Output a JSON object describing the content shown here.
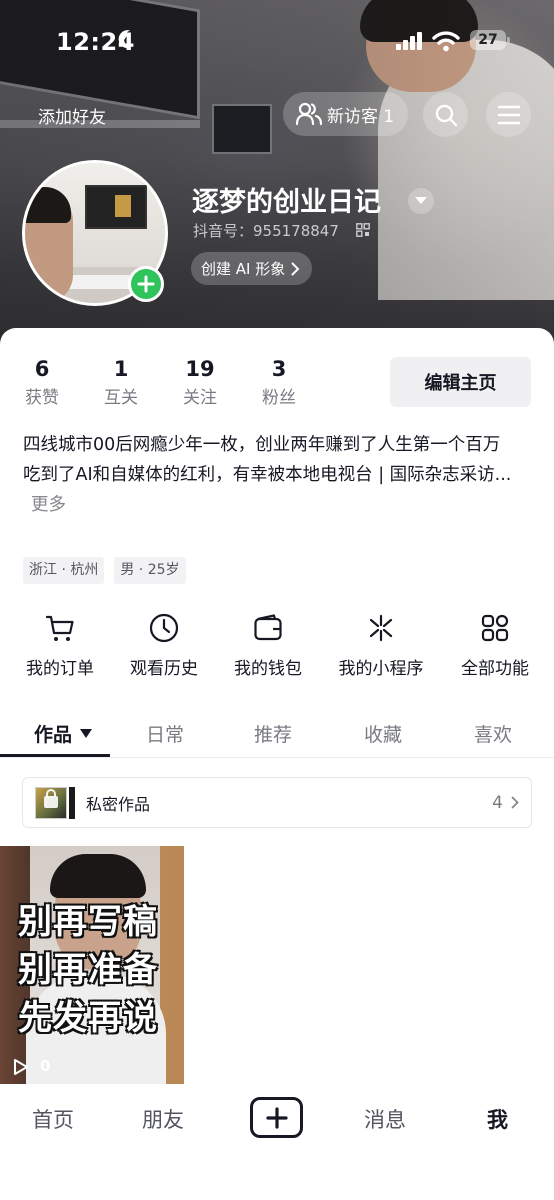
{
  "status_bar": {
    "time": "12:24",
    "battery": "27"
  },
  "top_bar": {
    "add_friend": "添加好友",
    "visitors": "新访客 1"
  },
  "profile": {
    "nickname": "逐梦的创业日记",
    "douyin_id": "抖音号：955178847",
    "ai_button": "创建 AI 形象"
  },
  "stats": [
    {
      "num": "6",
      "label": "获赞"
    },
    {
      "num": "1",
      "label": "互关"
    },
    {
      "num": "19",
      "label": "关注"
    },
    {
      "num": "3",
      "label": "粉丝"
    }
  ],
  "edit_button": "编辑主页",
  "bio": {
    "line1": "四线城市00后网瘾少年一枚，创业两年赚到了人生第一个百万",
    "line2": "吃到了AI和自媒体的红利，有幸被本地电视台 | 国际杂志采访...",
    "more": "更多"
  },
  "tags": [
    "浙江 · 杭州",
    "男 · 25岁"
  ],
  "functions": [
    {
      "label": "我的订单",
      "icon": "cart-icon"
    },
    {
      "label": "观看历史",
      "icon": "clock-icon"
    },
    {
      "label": "我的钱包",
      "icon": "wallet-icon"
    },
    {
      "label": "我的小程序",
      "icon": "mini-program-icon"
    },
    {
      "label": "全部功能",
      "icon": "grid-icon"
    }
  ],
  "tabs": [
    "作品",
    "日常",
    "推荐",
    "收藏",
    "喜欢"
  ],
  "private_works": {
    "label": "私密作品",
    "count": "4"
  },
  "video": {
    "caption": [
      "别再写稿",
      "别再准备",
      "先发再说"
    ],
    "plays": "0"
  },
  "bottom_nav": {
    "home": "首页",
    "friends": "朋友",
    "messages": "消息",
    "me": "我"
  }
}
